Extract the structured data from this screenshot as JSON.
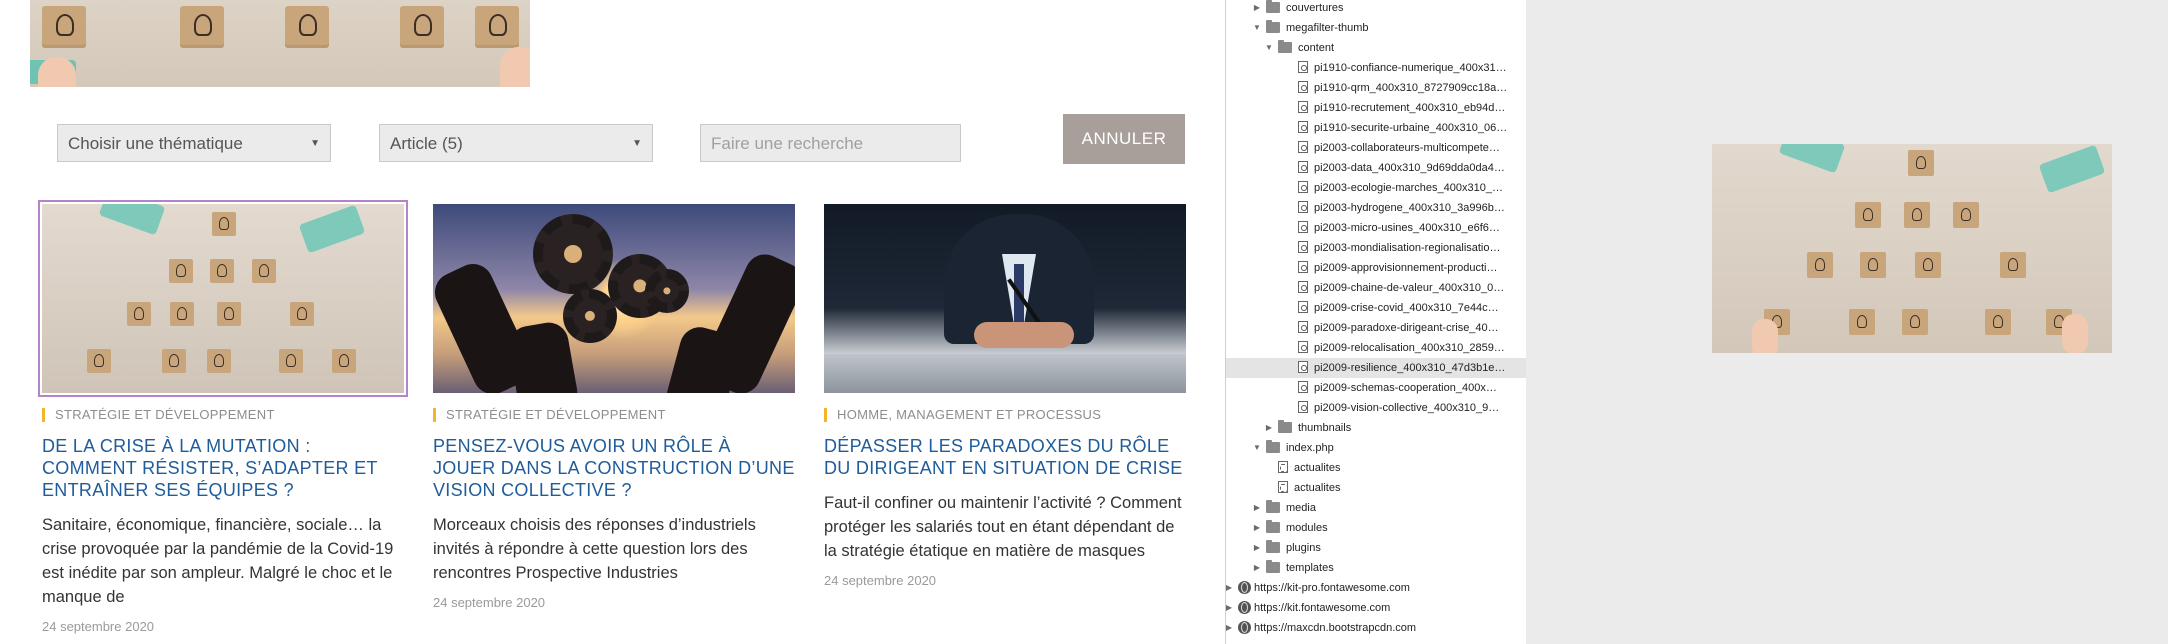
{
  "filters": {
    "theme_select": "Choisir une thématique",
    "type_select": "Article (5)",
    "search_placeholder": "Faire une recherche",
    "cancel_label": "ANNULER"
  },
  "articles": [
    {
      "category": "STRATÉGIE ET DÉVELOPPEMENT",
      "title": "DE LA CRISE À LA MUTATION : COMMENT RÉSISTER, S’ADAPTER ET ENTRAÎNER SES ÉQUIPES ?",
      "excerpt": "Sanitaire, économique, financière, sociale… la crise provoquée par la pandémie de la Covid-19 est inédite par son ampleur. Malgré le choc et le manque de",
      "date": "24 septembre 2020"
    },
    {
      "category": "STRATÉGIE ET DÉVELOPPEMENT",
      "title": "PENSEZ-VOUS AVOIR UN RÔLE À JOUER DANS LA CONSTRUCTION D’UNE VISION COLLECTIVE ?",
      "excerpt": "Morceaux choisis des réponses d’industriels invités à répondre à cette question lors des rencontres Prospective Industries",
      "date": "24 septembre 2020"
    },
    {
      "category": "HOMME, MANAGEMENT ET PROCESSUS",
      "title": "DÉPASSER LES PARADOXES DU RÔLE DU DIRIGEANT EN SITUATION DE CRISE",
      "excerpt": "Faut-il confiner ou maintenir l’activité ? Comment protéger les salariés tout en étant dépendant de la stratégie étatique en matière de masques",
      "date": "24 septembre 2020"
    }
  ],
  "tree": {
    "items": [
      {
        "label": "couvertures",
        "type": "folder",
        "twisty": "▶"
      },
      {
        "label": "megafilter-thumb",
        "type": "folder",
        "twisty": "▼"
      },
      {
        "label": "content",
        "type": "folder",
        "twisty": "▼"
      },
      {
        "label": "pi1910-confiance-numerique_400x31…",
        "type": "file"
      },
      {
        "label": "pi1910-qrm_400x310_8727909cc18a…",
        "type": "file"
      },
      {
        "label": "pi1910-recrutement_400x310_eb94d…",
        "type": "file"
      },
      {
        "label": "pi1910-securite-urbaine_400x310_06…",
        "type": "file"
      },
      {
        "label": "pi2003-collaborateurs-multicompete…",
        "type": "file"
      },
      {
        "label": "pi2003-data_400x310_9d69dda0da4…",
        "type": "file"
      },
      {
        "label": "pi2003-ecologie-marches_400x310_…",
        "type": "file"
      },
      {
        "label": "pi2003-hydrogene_400x310_3a996b…",
        "type": "file"
      },
      {
        "label": "pi2003-micro-usines_400x310_e6f6…",
        "type": "file"
      },
      {
        "label": "pi2003-mondialisation-regionalisatio…",
        "type": "file"
      },
      {
        "label": "pi2009-approvisionnement-producti…",
        "type": "file"
      },
      {
        "label": "pi2009-chaine-de-valeur_400x310_0…",
        "type": "file"
      },
      {
        "label": "pi2009-crise-covid_400x310_7e44c…",
        "type": "file"
      },
      {
        "label": "pi2009-paradoxe-dirigeant-crise_40…",
        "type": "file"
      },
      {
        "label": "pi2009-relocalisation_400x310_2859…",
        "type": "file"
      },
      {
        "label": "pi2009-resilience_400x310_47d3b1e…",
        "type": "file",
        "selected": true
      },
      {
        "label": "pi2009-schemas-cooperation_400x…",
        "type": "file"
      },
      {
        "label": "pi2009-vision-collective_400x310_9…",
        "type": "file"
      },
      {
        "label": "thumbnails",
        "type": "folder",
        "twisty": "▶"
      },
      {
        "label": "index.php",
        "type": "folder",
        "twisty": "▼"
      },
      {
        "label": "actualites",
        "type": "script"
      },
      {
        "label": "actualites",
        "type": "script"
      },
      {
        "label": "media",
        "type": "folder",
        "twisty": "▶"
      },
      {
        "label": "modules",
        "type": "folder",
        "twisty": "▶"
      },
      {
        "label": "plugins",
        "type": "folder",
        "twisty": "▶"
      },
      {
        "label": "templates",
        "type": "folder",
        "twisty": "▶"
      },
      {
        "label": "https://kit-pro.fontawesome.com",
        "type": "domain",
        "twisty": "▶"
      },
      {
        "label": "https://kit.fontawesome.com",
        "type": "domain",
        "twisty": "▶"
      },
      {
        "label": "https://maxcdn.bootstrapcdn.com",
        "type": "domain",
        "twisty": "▶"
      }
    ]
  },
  "colors": {
    "title_blue": "#1f5c9b",
    "category_bar": "#f3b52b",
    "cancel_button": "#a89f9a",
    "selected_outline": "#b483c9"
  }
}
